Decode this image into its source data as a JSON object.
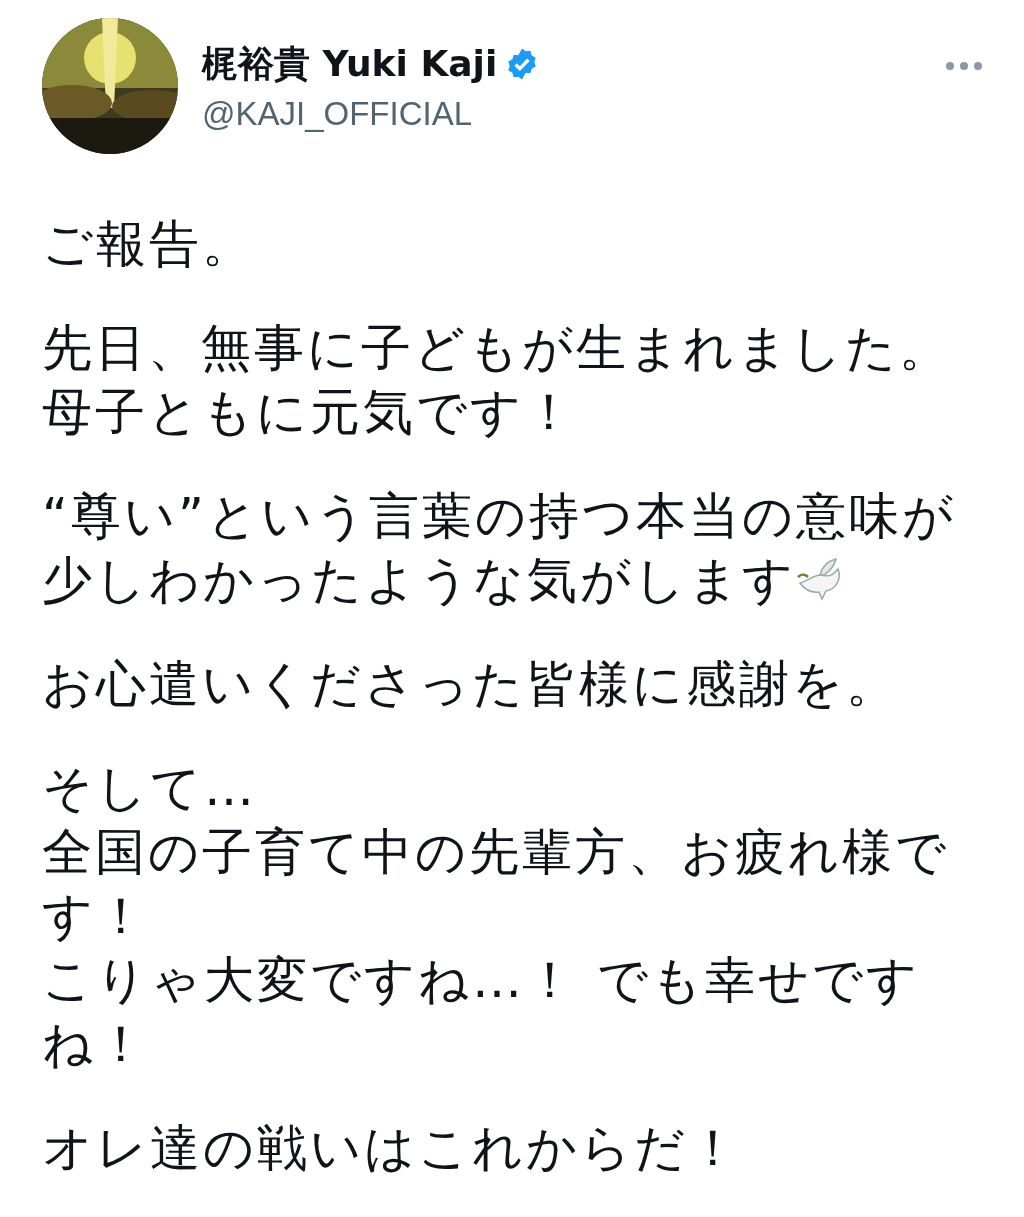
{
  "author": {
    "name": "梶裕貴 Yuki Kaji",
    "verified": true,
    "handle": "@KAJI_OFFICIAL"
  },
  "paragraphs": [
    {
      "lines": [
        "ご報告。"
      ]
    },
    {
      "lines": [
        "先日、無事に子どもが生まれました。",
        "母子ともに元気です！"
      ]
    },
    {
      "lines": [
        "“尊い”という言葉の持つ本当の意味が",
        "少しわかったような気がします"
      ],
      "dove": true
    },
    {
      "lines": [
        "お心遣いくださった皆様に感謝を。"
      ]
    },
    {
      "lines": [
        "そして…",
        "全国の子育て中の先輩方、お疲れ様です！",
        "こりゃ大変ですね…！ でも幸せですね！"
      ]
    },
    {
      "lines": [
        "オレ達の戦いはこれからだ！"
      ]
    }
  ]
}
